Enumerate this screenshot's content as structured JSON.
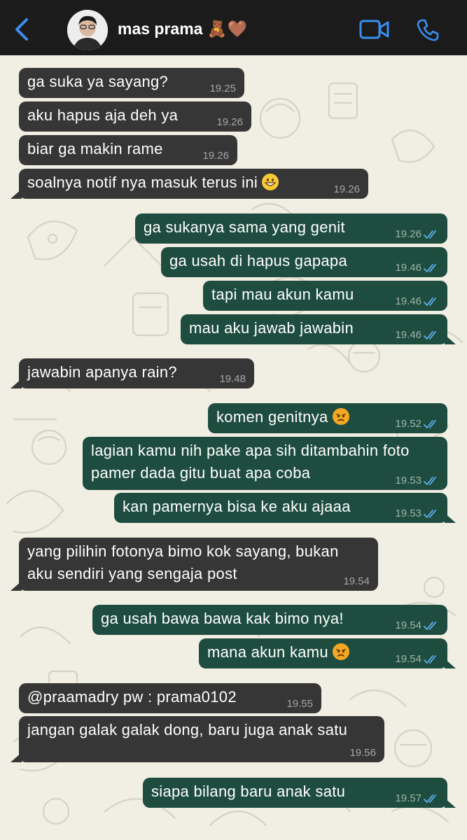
{
  "header": {
    "contact_name": "mas prama 🧸🤎",
    "back_icon": "chevron-left-icon",
    "video_icon": "video-camera-icon",
    "call_icon": "phone-icon",
    "accent_color": "#3a8ef0"
  },
  "colors": {
    "incoming_bubble": "#363636",
    "outgoing_bubble": "#1e4d40",
    "wallpaper": "#f1eee3",
    "read_ticks": "#5fb0f0"
  },
  "messages": [
    {
      "direction": "in",
      "text": "ga suka ya sayang?",
      "time": "19.25"
    },
    {
      "direction": "in",
      "text": "aku hapus aja deh ya",
      "time": "19.26"
    },
    {
      "direction": "in",
      "text": "biar ga makin rame",
      "time": "19.26"
    },
    {
      "direction": "in",
      "text": "soalnya notif nya masuk terus ini",
      "emoji": "grinning-face",
      "time": "19.26"
    },
    {
      "direction": "out",
      "text": "ga sukanya sama yang genit",
      "time": "19.26",
      "status": "read"
    },
    {
      "direction": "out",
      "text": "ga usah di hapus gapapa",
      "time": "19.46",
      "status": "read"
    },
    {
      "direction": "out",
      "text": "tapi mau akun kamu",
      "time": "19.46",
      "status": "read"
    },
    {
      "direction": "out",
      "text": "mau aku jawab jawabin",
      "time": "19.46",
      "status": "read"
    },
    {
      "direction": "in",
      "text": "jawabin apanya rain?",
      "time": "19.48"
    },
    {
      "direction": "out",
      "text": "komen genitnya",
      "emoji": "angry-face",
      "time": "19.52",
      "status": "read"
    },
    {
      "direction": "out",
      "text": "lagian kamu nih pake apa sih ditambahin foto\npamer dada gitu buat apa coba",
      "time": "19.53",
      "status": "read"
    },
    {
      "direction": "out",
      "text": "kan pamernya bisa ke aku ajaaa",
      "time": "19.53",
      "status": "read"
    },
    {
      "direction": "in",
      "text": "yang pilihin fotonya bimo kok sayang, bukan\naku sendiri yang sengaja post",
      "time": "19.54"
    },
    {
      "direction": "out",
      "text": "ga usah bawa bawa kak bimo nya!",
      "time": "19.54",
      "status": "read"
    },
    {
      "direction": "out",
      "text": "mana akun kamu",
      "emoji": "angry-face",
      "time": "19.54",
      "status": "read"
    },
    {
      "direction": "in",
      "text": "@praamadry pw : prama0102",
      "time": "19.55"
    },
    {
      "direction": "in",
      "text": "jangan galak galak dong, baru juga anak satu",
      "time": "19.56"
    },
    {
      "direction": "out",
      "text": "siapa bilang baru anak satu",
      "time": "19.57",
      "status": "read"
    }
  ]
}
